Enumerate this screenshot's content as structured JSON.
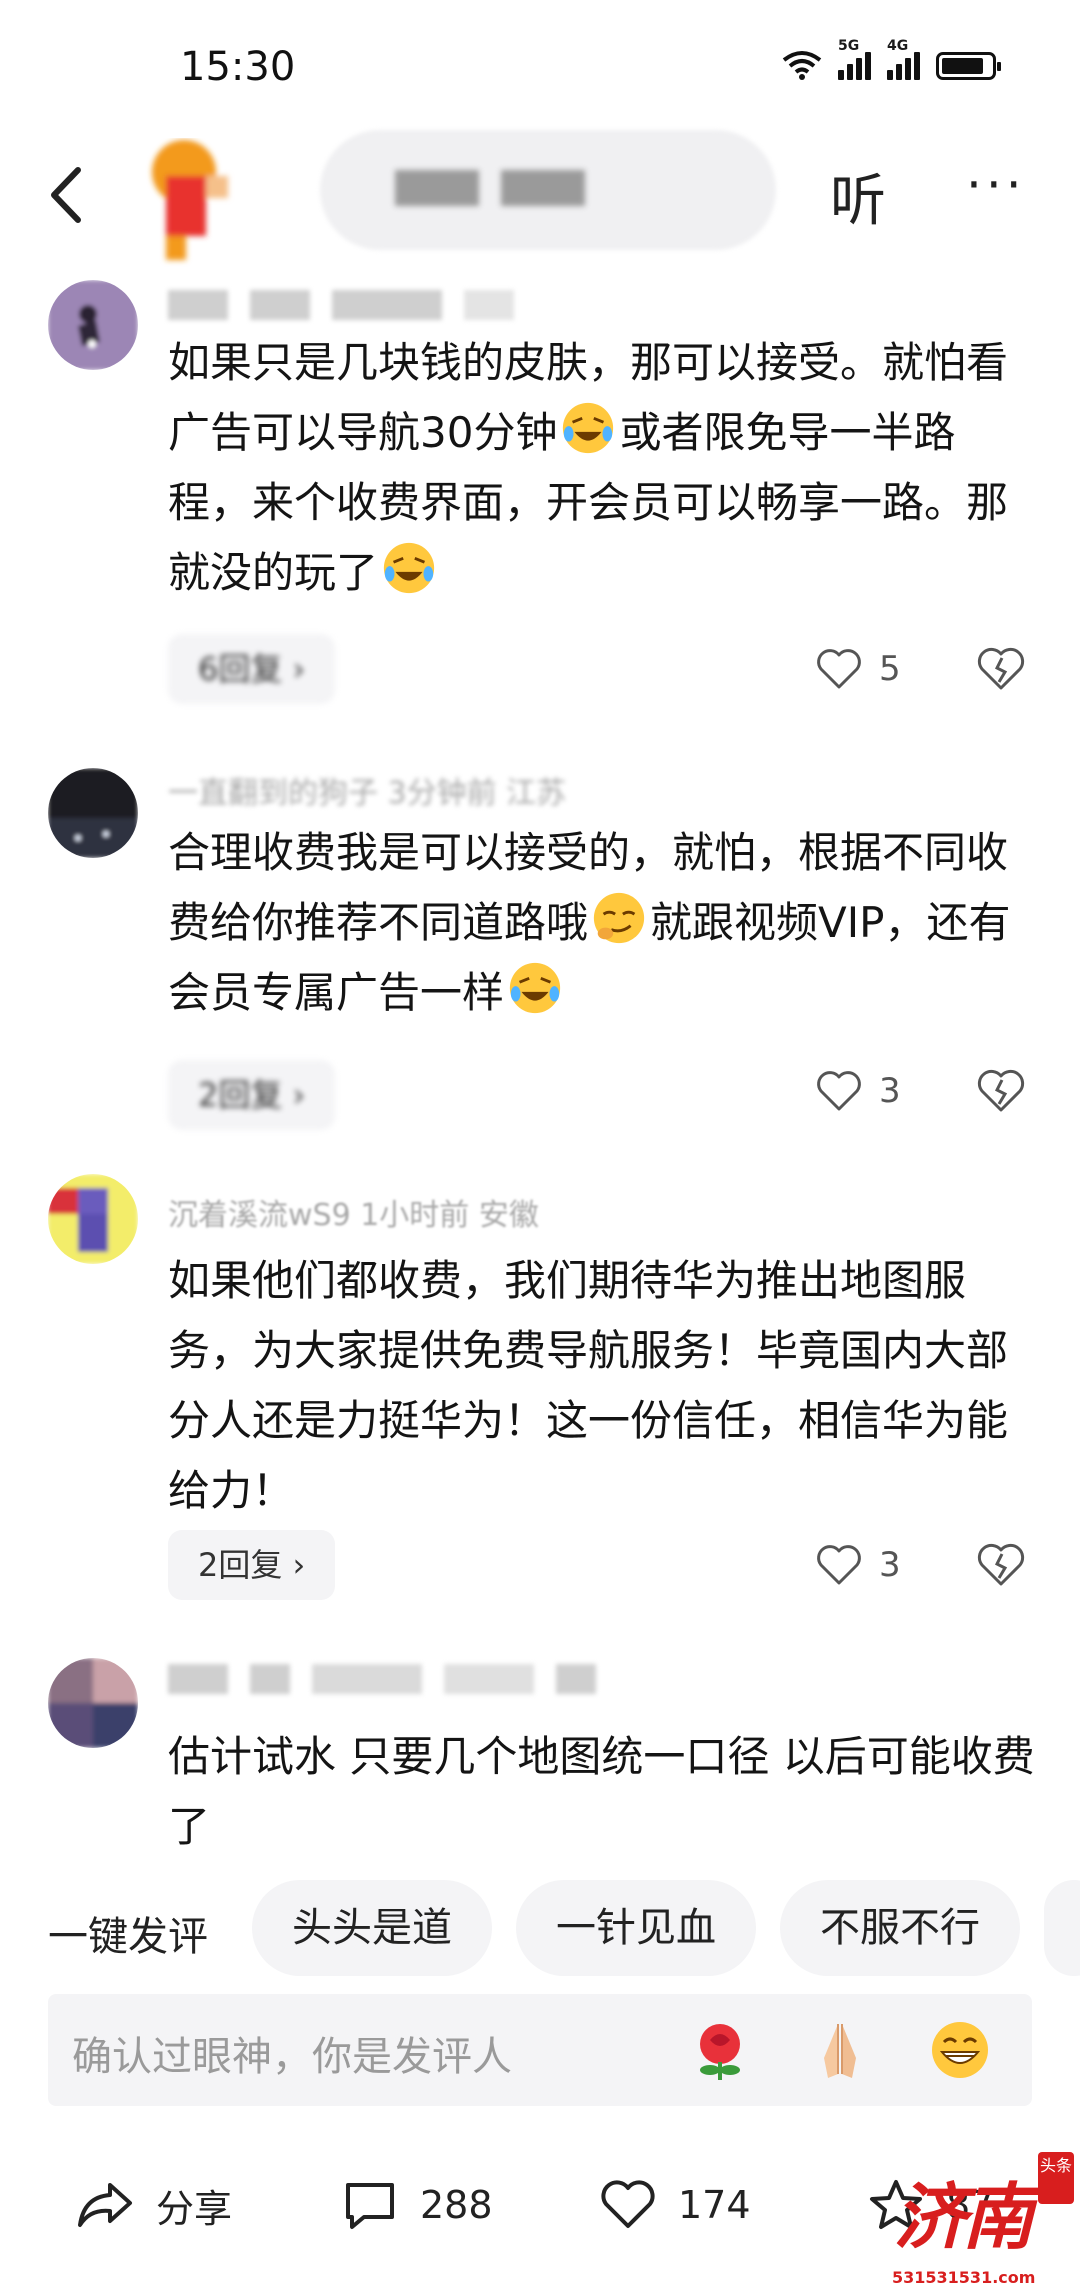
{
  "status_bar": {
    "time": "15:30",
    "network_1": "5G",
    "network_2": "4G"
  },
  "header": {
    "listen_label": "听",
    "more_label": "···"
  },
  "comments": [
    {
      "text_parts": [
        "如果只是几块钱的皮肤，那可以接受。就怕看广告可以导航30分钟",
        "或者限免导一半路程，来个收费界面，开会员可以畅享一路。那就没的玩了"
      ],
      "reply_label": "6回复 ›",
      "likes": "5"
    },
    {
      "meta": "一直翻到的狗子 3分钟前 江苏",
      "text_parts": [
        "合理收费我是可以接受的，就怕，根据不同收费给你推荐不同道路哦",
        "就跟视频VIP，还有会员专属广告一样"
      ],
      "reply_label": "2回复 ›",
      "likes": "3"
    },
    {
      "meta": "沉着溪流wS9  1小时前  安徽",
      "text": "如果他们都收费，我们期待华为推出地图服务，为大家提供免费导航服务！毕竟国内大部分人还是力挺华为！这一份信任，相信华为能给力！",
      "reply_label": "2回复 ›",
      "likes": "3"
    },
    {
      "text": "估计试水 只要几个地图统一口径 以后可能收费了"
    }
  ],
  "quick_reply": {
    "label": "一键发评",
    "chips": [
      "头头是道",
      "一针见血",
      "不服不行"
    ]
  },
  "input": {
    "placeholder": "确认过眼神，你是发评人"
  },
  "bottom_bar": {
    "share_label": "分享",
    "comment_count": "288",
    "like_count": "174",
    "favorite_count": "87"
  },
  "watermark": {
    "text": "济南",
    "sub": "531531531.com",
    "badge": "头条"
  },
  "colors": {
    "accent_orange": "#f39a1f",
    "logo_red": "#e8322e",
    "watermark_red": "#d81e1e"
  }
}
